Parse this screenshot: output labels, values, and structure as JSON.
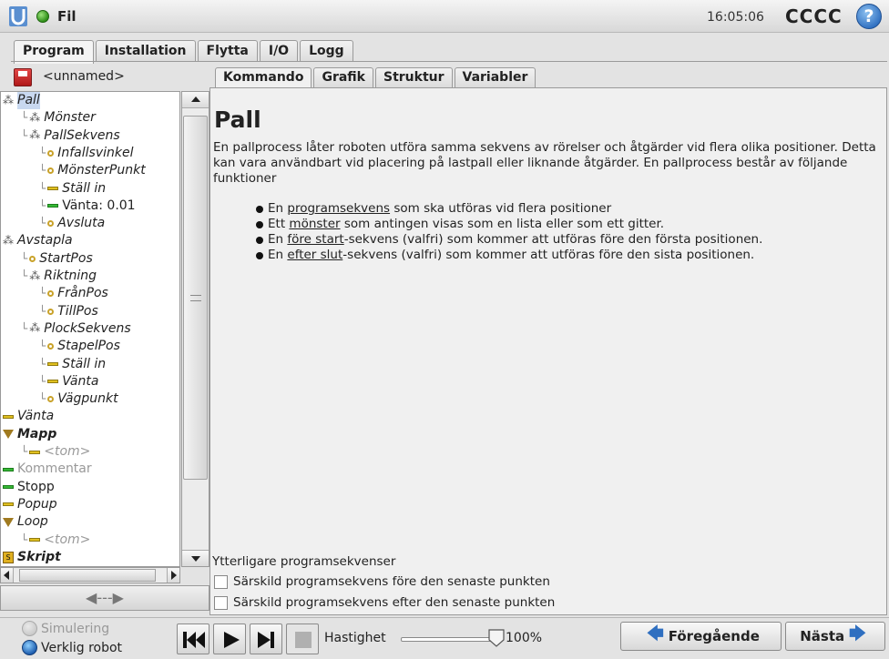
{
  "topbar": {
    "title": "Fil",
    "time": "16:05:06",
    "robot_name": "CCCC",
    "help_label": "?"
  },
  "main_tabs": [
    "Program",
    "Installation",
    "Flytta",
    "I/O",
    "Logg"
  ],
  "program": {
    "name": "<unnamed>"
  },
  "tree": [
    {
      "label": "Pall",
      "icon": "folder",
      "style": "sel"
    },
    {
      "label": "Mönster",
      "icon": "folder",
      "style": "it"
    },
    {
      "label": "PallSekvens",
      "icon": "folder",
      "style": "it"
    },
    {
      "label": "Infallsvinkel",
      "icon": "waypoint",
      "style": "it"
    },
    {
      "label": "MönsterPunkt",
      "icon": "waypoint",
      "style": "it"
    },
    {
      "label": "Ställ in",
      "icon": "set",
      "style": "it"
    },
    {
      "label": "Vänta: 0.01",
      "icon": "wait-green",
      "style": "plain"
    },
    {
      "label": "Avsluta",
      "icon": "waypoint",
      "style": "it"
    },
    {
      "label": "Avstapla",
      "icon": "folder",
      "style": "it"
    },
    {
      "label": "StartPos",
      "icon": "waypoint",
      "style": "it"
    },
    {
      "label": "Riktning",
      "icon": "folder",
      "style": "it"
    },
    {
      "label": "FrånPos",
      "icon": "waypoint",
      "style": "it"
    },
    {
      "label": "TillPos",
      "icon": "waypoint",
      "style": "it"
    },
    {
      "label": "PlockSekvens",
      "icon": "folder",
      "style": "it"
    },
    {
      "label": "StapelPos",
      "icon": "waypoint",
      "style": "it"
    },
    {
      "label": "Ställ in",
      "icon": "set",
      "style": "it"
    },
    {
      "label": "Vänta",
      "icon": "wait",
      "style": "it"
    },
    {
      "label": "Vägpunkt",
      "icon": "waypoint",
      "style": "it"
    },
    {
      "label": "Vänta",
      "icon": "wait",
      "style": "it"
    },
    {
      "label": "Mapp",
      "icon": "triangle",
      "style": "b"
    },
    {
      "label": "<tom>",
      "icon": "wait",
      "style": "grey-it"
    },
    {
      "label": "Kommentar",
      "icon": "comment-green",
      "style": "grey"
    },
    {
      "label": "Stopp",
      "icon": "stop-green",
      "style": "plain"
    },
    {
      "label": "Popup",
      "icon": "wait",
      "style": "it"
    },
    {
      "label": "Loop",
      "icon": "triangle",
      "style": "it"
    },
    {
      "label": "<tom>",
      "icon": "wait",
      "style": "grey-it"
    },
    {
      "label": "Skript",
      "icon": "script",
      "style": "b"
    }
  ],
  "move_button": "◀---▶",
  "sub_tabs": [
    "Kommando",
    "Grafik",
    "Struktur",
    "Variabler"
  ],
  "content": {
    "title": "Pall",
    "description": "En pallprocess låter roboten utföra samma sekvens av rörelser och åtgärder vid flera olika positioner. Detta kan vara användbart vid placering på lastpall eller liknande åtgärder. En pallprocess består av följande funktioner",
    "items": [
      {
        "pre": "En ",
        "link": "programsekvens",
        "post": " som ska utföras vid flera positioner"
      },
      {
        "pre": "Ett ",
        "link": "mönster",
        "post": " som antingen visas som en lista eller som ett gitter."
      },
      {
        "pre": "En ",
        "link": "före start",
        "post": "-sekvens (valfri) som kommer att utföras före den första positionen."
      },
      {
        "pre": "En ",
        "link": "efter slut",
        "post": "-sekvens (valfri) som kommer att utföras före den sista positionen."
      }
    ],
    "extra_label": "Ytterligare programsekvenser",
    "check_before": "Särskild programsekvens före den senaste punkten",
    "check_after": "Särskild programsekvens efter den senaste punkten"
  },
  "bottom": {
    "sim_label": "Simulering",
    "real_label": "Verklig robot",
    "speed_label": "Hastighet",
    "speed_value": "100%",
    "prev_label": "Föregående",
    "next_label": "Nästa"
  }
}
